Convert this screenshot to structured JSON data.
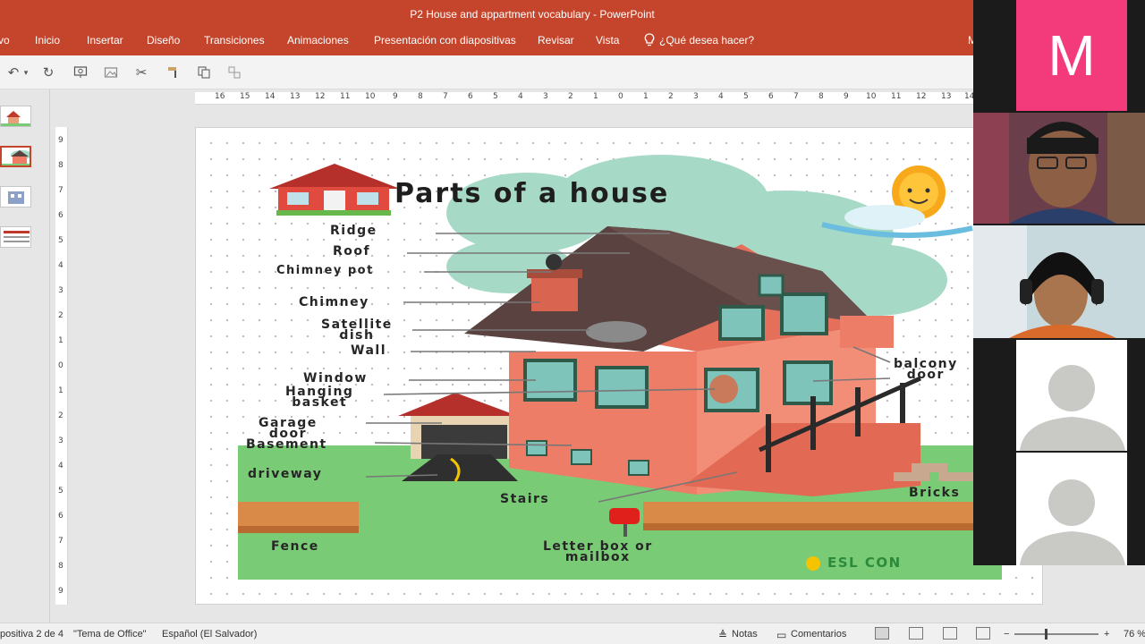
{
  "window": {
    "title": "P2 House and appartment vocabulary - PowerPoint"
  },
  "ribbon": {
    "tabs": [
      "vo",
      "Inicio",
      "Insertar",
      "Diseño",
      "Transiciones",
      "Animaciones",
      "Presentación con diapositivas",
      "Revisar",
      "Vista"
    ],
    "tell_me": "¿Qué desea hacer?",
    "user_initial": "M"
  },
  "slide": {
    "title": "Parts of a house",
    "labels": {
      "ridge": "Ridge",
      "roof": "Roof",
      "chimney_pot": "Chimney pot",
      "chimney": "Chimney",
      "satellite_dish": "Satellite\ndish",
      "wall": "Wall",
      "window": "Window",
      "hanging_basket": "Hanging\nbasket",
      "garage_door": "Garage\ndoor",
      "basement": "Basement",
      "driveway": "driveway",
      "stairs": "Stairs",
      "fence": "Fence",
      "letter_box": "Letter box or\nmailbox",
      "balcony_door": "balcony\ndoor",
      "bricks": "Bricks",
      "watermark": "ESL CON"
    }
  },
  "ruler": {
    "top": [
      "16",
      "15",
      "14",
      "13",
      "12",
      "11",
      "10",
      "9",
      "8",
      "7",
      "6",
      "5",
      "4",
      "3",
      "2",
      "1",
      "0",
      "1",
      "2",
      "3",
      "4",
      "5",
      "6",
      "7",
      "8",
      "9",
      "10",
      "11",
      "12",
      "13",
      "14"
    ],
    "left": [
      "9",
      "8",
      "7",
      "6",
      "5",
      "4",
      "3",
      "2",
      "1",
      "0",
      "1",
      "2",
      "3",
      "4",
      "5",
      "6",
      "7",
      "8",
      "9"
    ]
  },
  "video": {
    "tile1_initial": "M",
    "tile1_color": "#f33a7a"
  },
  "status": {
    "slide_count": "positiva 2 de 4",
    "theme": "\"Tema de Office\"",
    "language": "Español (El Salvador)",
    "notes": "Notas",
    "comments": "Comentarios",
    "zoom": "76 %"
  },
  "colors": {
    "ribbon": "#c4452b",
    "house_wall": "#ee7d68",
    "roof": "#5a4240",
    "grass": "#7acb76",
    "cloud": "#a7d9c7"
  }
}
